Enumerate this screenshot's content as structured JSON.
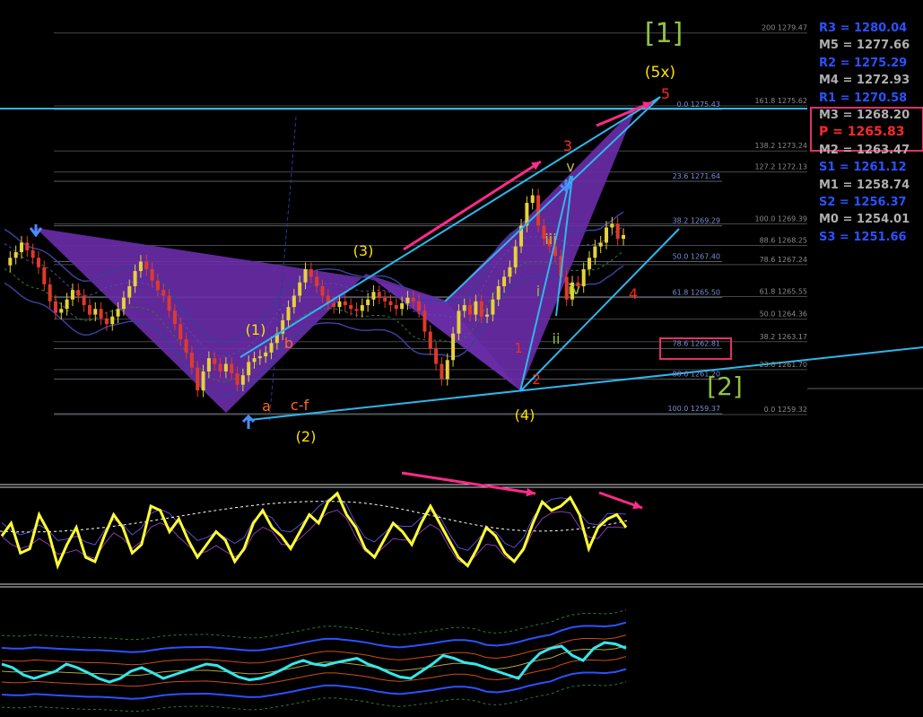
{
  "chart_data": {
    "type": "line",
    "title": "",
    "xlabel": "",
    "ylabel": "",
    "ylim": [
      1258.5,
      1281.5
    ],
    "grid": false,
    "colors": {
      "background": "#000000",
      "candle_up": "#e6d23a",
      "candle_down": "#e03a2a",
      "harmonic_fill": "#6a2ca8",
      "trend_lines": "#2fb6ee",
      "arrows": "#ff2a8a",
      "yellow_label": "#ffe000",
      "red_label": "#ff2a1a",
      "green_label": "#8fc33a",
      "fib_text": "#7a8ccf",
      "fib_text_right": "#8a8a8a",
      "osc_yellow": "#ffff33",
      "osc_cyan": "#33e8ee"
    },
    "price_series": [
      1267.2,
      1267.6,
      1267.9,
      1268.4,
      1268.0,
      1267.6,
      1267.1,
      1266.2,
      1265.3,
      1264.7,
      1264.9,
      1265.4,
      1265.9,
      1265.6,
      1265.1,
      1264.6,
      1264.9,
      1264.4,
      1264.1,
      1264.5,
      1264.9,
      1265.5,
      1266.1,
      1266.9,
      1267.4,
      1267.0,
      1266.4,
      1265.9,
      1265.6,
      1264.8,
      1264.1,
      1263.3,
      1262.6,
      1261.8,
      1260.6,
      1261.6,
      1262.3,
      1262.0,
      1261.6,
      1262.0,
      1261.5,
      1260.9,
      1261.4,
      1262.1,
      1262.3,
      1262.4,
      1262.6,
      1263.1,
      1263.6,
      1264.3,
      1265.0,
      1265.6,
      1266.3,
      1267.0,
      1266.6,
      1266.1,
      1265.6,
      1265.2,
      1265.0,
      1265.3,
      1265.1,
      1264.9,
      1264.8,
      1265.1,
      1265.4,
      1265.8,
      1265.5,
      1265.3,
      1265.1,
      1264.9,
      1265.2,
      1265.5,
      1265.3,
      1264.8,
      1263.7,
      1262.8,
      1262.0,
      1261.2,
      1262.2,
      1263.6,
      1264.8,
      1265.1,
      1264.6,
      1265.3,
      1264.5,
      1264.6,
      1265.4,
      1266.1,
      1266.6,
      1267.1,
      1268.2,
      1269.3,
      1270.5,
      1270.9,
      1269.3,
      1268.6,
      1268.2,
      1267.7,
      1266.6,
      1265.4,
      1266.3,
      1266.1,
      1267.0,
      1267.6,
      1268.2,
      1268.4,
      1269.2,
      1269.4,
      1268.6,
      1268.8
    ],
    "candles_note": "",
    "fib_levels_left": [
      {
        "pct": "0.0",
        "price": 1275.43,
        "label": "0.0 1275.43"
      },
      {
        "pct": "23.6",
        "price": 1271.64,
        "label": "23.6 1271.64"
      },
      {
        "pct": "38.2",
        "price": 1269.29,
        "label": "38.2 1269.29"
      },
      {
        "pct": "50.0",
        "price": 1267.4,
        "label": "50.0 1267.40"
      },
      {
        "pct": "61.8",
        "price": 1265.5,
        "label": "61.8 1265.50"
      },
      {
        "pct": "78.6",
        "price": 1262.81,
        "label": "78.6 1262.81"
      },
      {
        "pct": "88.6",
        "price": 1261.2,
        "label": "88.6 1261.20"
      },
      {
        "pct": "100.0",
        "price": 1259.37,
        "label": "100.0 1259.37"
      }
    ],
    "fib_levels_right": [
      {
        "pct": "200",
        "price": 1279.47,
        "label": "200 1279.47"
      },
      {
        "pct": "161.8",
        "price": 1275.62,
        "label": "161.8 1275.62"
      },
      {
        "pct": "138.2",
        "price": 1273.24,
        "label": "138.2 1273.24"
      },
      {
        "pct": "127.2",
        "price": 1272.13,
        "label": "127.2 1272.13"
      },
      {
        "pct": "100.0",
        "price": 1269.39,
        "label": "100.0 1269.39"
      },
      {
        "pct": "88.6",
        "price": 1268.25,
        "label": "88.6 1268.25"
      },
      {
        "pct": "78.6",
        "price": 1267.24,
        "label": "78.6 1267.24"
      },
      {
        "pct": "61.8",
        "price": 1265.55,
        "label": "61.8 1265.55"
      },
      {
        "pct": "50.0",
        "price": 1264.36,
        "label": "50.0 1264.36"
      },
      {
        "pct": "38.2",
        "price": 1263.17,
        "label": "38.2 1263.17"
      },
      {
        "pct": "23.6",
        "price": 1261.7,
        "label": "23.6 1261.70"
      },
      {
        "pct": "0.0",
        "price": 1259.32,
        "label": "0.0 1259.32"
      }
    ],
    "pivot_levels": [
      {
        "label": "R3 = 1280.04",
        "color": "#2a52ff"
      },
      {
        "label": "M5 = 1277.66",
        "color": "#b0b0b0"
      },
      {
        "label": "R2 = 1275.29",
        "color": "#2a52ff"
      },
      {
        "label": "M4 = 1272.93",
        "color": "#b0b0b0"
      },
      {
        "label": "R1 = 1270.58",
        "color": "#2a52ff"
      },
      {
        "label": "M3 = 1268.20",
        "color": "#b0b0b0"
      },
      {
        "label": "P   = 1265.83",
        "color": "#ff2a2a"
      },
      {
        "label": "M2 = 1263.47",
        "color": "#b0b0b0"
      },
      {
        "label": "S1 = 1261.12",
        "color": "#2a52ff"
      },
      {
        "label": "M1 = 1258.74",
        "color": "#b0b0b0"
      },
      {
        "label": "S2 = 1256.37",
        "color": "#2a52ff"
      },
      {
        "label": "M0 = 1254.01",
        "color": "#b0b0b0"
      },
      {
        "label": "S3 = 1251.66",
        "color": "#2a52ff"
      }
    ],
    "wave_labels": [
      {
        "text": "[1]",
        "color": "#8fc33a"
      },
      {
        "text": "[2]",
        "color": "#8fc33a"
      },
      {
        "text": "(5x)",
        "color": "#ffe000"
      },
      {
        "text": "(1)",
        "color": "#ffe000"
      },
      {
        "text": "(2)",
        "color": "#ffe000"
      },
      {
        "text": "(3)",
        "color": "#ffe000"
      },
      {
        "text": "(4)",
        "color": "#ffe000"
      },
      {
        "text": "5",
        "color": "#ff2a1a"
      },
      {
        "text": "3",
        "color": "#ff2a1a"
      },
      {
        "text": "4",
        "color": "#ff2a1a"
      },
      {
        "text": "1",
        "color": "#ff2a1a"
      },
      {
        "text": "2",
        "color": "#ff2a1a"
      },
      {
        "text": "a",
        "color": "#ff6a1a"
      },
      {
        "text": "b",
        "color": "#ff6a1a"
      },
      {
        "text": "c-f",
        "color": "#ff6a1a"
      },
      {
        "text": "v",
        "color": "#c8b84a"
      },
      {
        "text": "iii",
        "color": "#c8b84a"
      },
      {
        "text": "iv",
        "color": "#8fc33a"
      },
      {
        "text": "ii",
        "color": "#8fc33a"
      },
      {
        "text": "i",
        "color": "#8fc33a"
      }
    ],
    "oscillator_1": [
      0.45,
      0.6,
      0.25,
      0.3,
      0.7,
      0.5,
      0.1,
      0.35,
      0.55,
      0.2,
      0.15,
      0.45,
      0.7,
      0.55,
      0.25,
      0.35,
      0.8,
      0.75,
      0.5,
      0.65,
      0.4,
      0.2,
      0.35,
      0.5,
      0.4,
      0.15,
      0.3,
      0.6,
      0.75,
      0.55,
      0.45,
      0.3,
      0.5,
      0.7,
      0.6,
      0.85,
      0.95,
      0.7,
      0.55,
      0.3,
      0.2,
      0.4,
      0.6,
      0.5,
      0.35,
      0.6,
      0.8,
      0.6,
      0.4,
      0.2,
      0.1,
      0.3,
      0.55,
      0.45,
      0.25,
      0.15,
      0.3,
      0.6,
      0.85,
      0.75,
      0.8,
      0.9,
      0.7,
      0.3,
      0.55,
      0.65,
      0.7,
      0.55
    ],
    "oscillator_2": [
      0.5,
      0.45,
      0.35,
      0.3,
      0.35,
      0.4,
      0.5,
      0.45,
      0.38,
      0.3,
      0.25,
      0.3,
      0.4,
      0.45,
      0.38,
      0.3,
      0.35,
      0.4,
      0.45,
      0.5,
      0.48,
      0.4,
      0.32,
      0.28,
      0.3,
      0.35,
      0.42,
      0.5,
      0.55,
      0.5,
      0.48,
      0.52,
      0.55,
      0.58,
      0.5,
      0.45,
      0.38,
      0.32,
      0.3,
      0.4,
      0.5,
      0.62,
      0.58,
      0.52,
      0.5,
      0.45,
      0.4,
      0.35,
      0.3,
      0.5,
      0.65,
      0.72,
      0.75,
      0.62,
      0.55,
      0.72,
      0.8,
      0.78,
      0.72
    ]
  }
}
